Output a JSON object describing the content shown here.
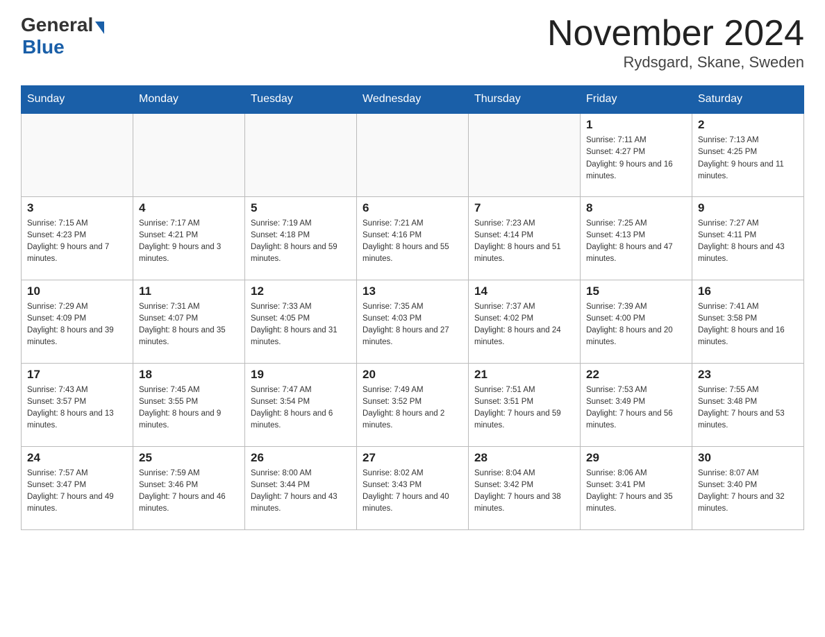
{
  "header": {
    "logo_general": "General",
    "logo_blue": "Blue",
    "month_title": "November 2024",
    "location": "Rydsgard, Skane, Sweden"
  },
  "days_of_week": [
    "Sunday",
    "Monday",
    "Tuesday",
    "Wednesday",
    "Thursday",
    "Friday",
    "Saturday"
  ],
  "weeks": [
    [
      {
        "day": "",
        "info": ""
      },
      {
        "day": "",
        "info": ""
      },
      {
        "day": "",
        "info": ""
      },
      {
        "day": "",
        "info": ""
      },
      {
        "day": "",
        "info": ""
      },
      {
        "day": "1",
        "info": "Sunrise: 7:11 AM\nSunset: 4:27 PM\nDaylight: 9 hours and 16 minutes."
      },
      {
        "day": "2",
        "info": "Sunrise: 7:13 AM\nSunset: 4:25 PM\nDaylight: 9 hours and 11 minutes."
      }
    ],
    [
      {
        "day": "3",
        "info": "Sunrise: 7:15 AM\nSunset: 4:23 PM\nDaylight: 9 hours and 7 minutes."
      },
      {
        "day": "4",
        "info": "Sunrise: 7:17 AM\nSunset: 4:21 PM\nDaylight: 9 hours and 3 minutes."
      },
      {
        "day": "5",
        "info": "Sunrise: 7:19 AM\nSunset: 4:18 PM\nDaylight: 8 hours and 59 minutes."
      },
      {
        "day": "6",
        "info": "Sunrise: 7:21 AM\nSunset: 4:16 PM\nDaylight: 8 hours and 55 minutes."
      },
      {
        "day": "7",
        "info": "Sunrise: 7:23 AM\nSunset: 4:14 PM\nDaylight: 8 hours and 51 minutes."
      },
      {
        "day": "8",
        "info": "Sunrise: 7:25 AM\nSunset: 4:13 PM\nDaylight: 8 hours and 47 minutes."
      },
      {
        "day": "9",
        "info": "Sunrise: 7:27 AM\nSunset: 4:11 PM\nDaylight: 8 hours and 43 minutes."
      }
    ],
    [
      {
        "day": "10",
        "info": "Sunrise: 7:29 AM\nSunset: 4:09 PM\nDaylight: 8 hours and 39 minutes."
      },
      {
        "day": "11",
        "info": "Sunrise: 7:31 AM\nSunset: 4:07 PM\nDaylight: 8 hours and 35 minutes."
      },
      {
        "day": "12",
        "info": "Sunrise: 7:33 AM\nSunset: 4:05 PM\nDaylight: 8 hours and 31 minutes."
      },
      {
        "day": "13",
        "info": "Sunrise: 7:35 AM\nSunset: 4:03 PM\nDaylight: 8 hours and 27 minutes."
      },
      {
        "day": "14",
        "info": "Sunrise: 7:37 AM\nSunset: 4:02 PM\nDaylight: 8 hours and 24 minutes."
      },
      {
        "day": "15",
        "info": "Sunrise: 7:39 AM\nSunset: 4:00 PM\nDaylight: 8 hours and 20 minutes."
      },
      {
        "day": "16",
        "info": "Sunrise: 7:41 AM\nSunset: 3:58 PM\nDaylight: 8 hours and 16 minutes."
      }
    ],
    [
      {
        "day": "17",
        "info": "Sunrise: 7:43 AM\nSunset: 3:57 PM\nDaylight: 8 hours and 13 minutes."
      },
      {
        "day": "18",
        "info": "Sunrise: 7:45 AM\nSunset: 3:55 PM\nDaylight: 8 hours and 9 minutes."
      },
      {
        "day": "19",
        "info": "Sunrise: 7:47 AM\nSunset: 3:54 PM\nDaylight: 8 hours and 6 minutes."
      },
      {
        "day": "20",
        "info": "Sunrise: 7:49 AM\nSunset: 3:52 PM\nDaylight: 8 hours and 2 minutes."
      },
      {
        "day": "21",
        "info": "Sunrise: 7:51 AM\nSunset: 3:51 PM\nDaylight: 7 hours and 59 minutes."
      },
      {
        "day": "22",
        "info": "Sunrise: 7:53 AM\nSunset: 3:49 PM\nDaylight: 7 hours and 56 minutes."
      },
      {
        "day": "23",
        "info": "Sunrise: 7:55 AM\nSunset: 3:48 PM\nDaylight: 7 hours and 53 minutes."
      }
    ],
    [
      {
        "day": "24",
        "info": "Sunrise: 7:57 AM\nSunset: 3:47 PM\nDaylight: 7 hours and 49 minutes."
      },
      {
        "day": "25",
        "info": "Sunrise: 7:59 AM\nSunset: 3:46 PM\nDaylight: 7 hours and 46 minutes."
      },
      {
        "day": "26",
        "info": "Sunrise: 8:00 AM\nSunset: 3:44 PM\nDaylight: 7 hours and 43 minutes."
      },
      {
        "day": "27",
        "info": "Sunrise: 8:02 AM\nSunset: 3:43 PM\nDaylight: 7 hours and 40 minutes."
      },
      {
        "day": "28",
        "info": "Sunrise: 8:04 AM\nSunset: 3:42 PM\nDaylight: 7 hours and 38 minutes."
      },
      {
        "day": "29",
        "info": "Sunrise: 8:06 AM\nSunset: 3:41 PM\nDaylight: 7 hours and 35 minutes."
      },
      {
        "day": "30",
        "info": "Sunrise: 8:07 AM\nSunset: 3:40 PM\nDaylight: 7 hours and 32 minutes."
      }
    ]
  ]
}
